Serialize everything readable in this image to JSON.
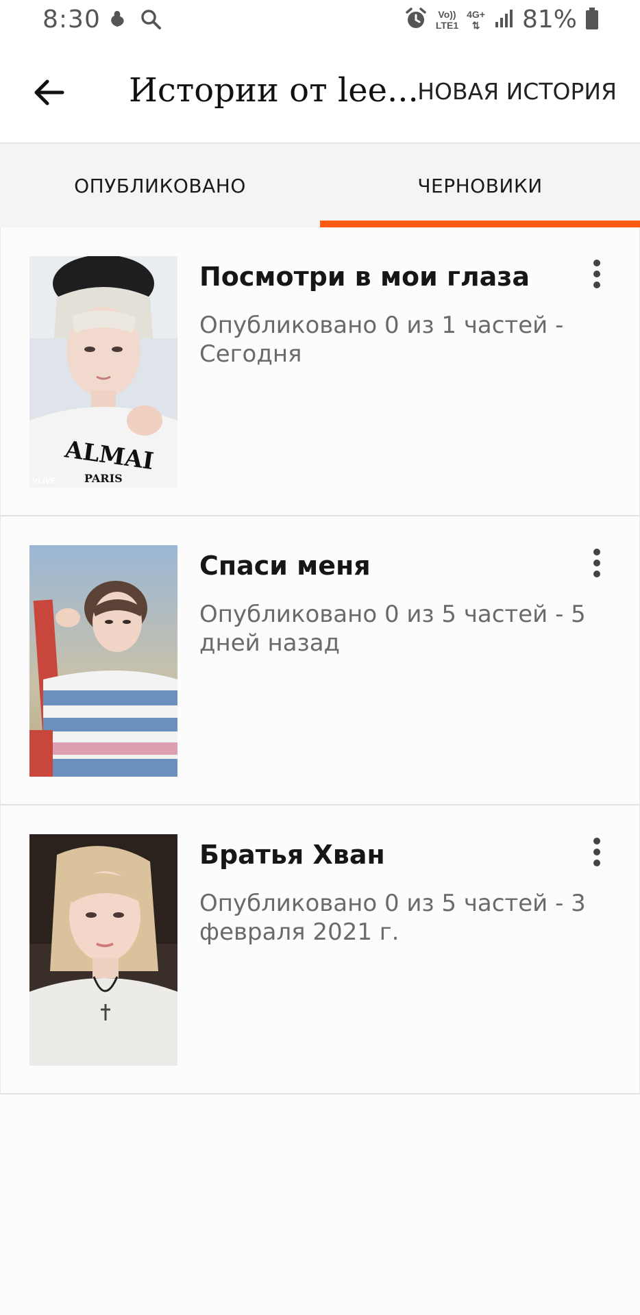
{
  "status_bar": {
    "time": "8:30",
    "net_top": "Vo))",
    "net_bottom": "LTE1",
    "net_type": "4G+",
    "battery": "81%"
  },
  "app_bar": {
    "title": "Истории от lee...",
    "new_story_label": "НОВАЯ ИСТОРИЯ"
  },
  "tabs": [
    {
      "label": "ОПУБЛИКОВАНО",
      "active": false
    },
    {
      "label": "ЧЕРНОВИКИ",
      "active": true
    }
  ],
  "accent_color": "#ff5a14",
  "stories": [
    {
      "title": "Посмотри в мои глаза",
      "meta": "Опубликовано 0 из 1 частей - Сегодня",
      "cover_watermark": "VLIVE"
    },
    {
      "title": "Спаси меня",
      "meta": "Опубликовано 0 из 5 частей - 5 дней назад"
    },
    {
      "title": "Братья Хван",
      "meta": "Опубликовано 0 из 5 частей - 3 февраля 2021 г."
    }
  ]
}
